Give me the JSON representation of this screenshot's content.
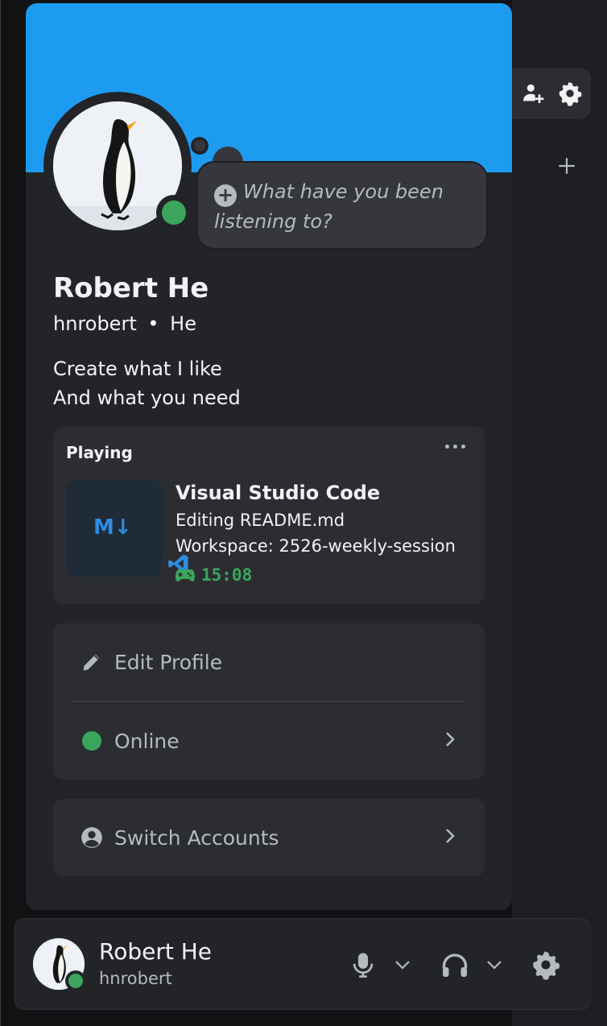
{
  "colors": {
    "banner": "#1d9bf0",
    "online": "#3ba55d",
    "card": "#232428",
    "panel": "#2b2d31"
  },
  "custom_status": {
    "placeholder": "What have you been listening to?"
  },
  "profile": {
    "display_name": "Robert He",
    "username": "hnrobert",
    "separator": "•",
    "pronouns": "He",
    "bio_line1": "Create what I like",
    "bio_line2": "And what you need",
    "status": "online"
  },
  "activity": {
    "header": "Playing",
    "image_text": "M↓",
    "app_name": "Visual Studio Code",
    "details": "Editing README.md",
    "state": "Workspace: 2526-weekly-session",
    "elapsed": "15:08"
  },
  "menu": {
    "edit_profile": "Edit Profile",
    "status": "Online",
    "switch_accounts": "Switch Accounts"
  },
  "user_panel": {
    "name": "Robert He",
    "handle": "hnrobert"
  },
  "icons": [
    "add-friend-icon",
    "gear-icon",
    "plus-icon",
    "pencil-icon",
    "chevron-right-icon",
    "account-icon",
    "microphone-icon",
    "headphones-icon",
    "chevron-down-icon",
    "gamepad-icon",
    "vscode-icon",
    "more-dots-icon"
  ]
}
